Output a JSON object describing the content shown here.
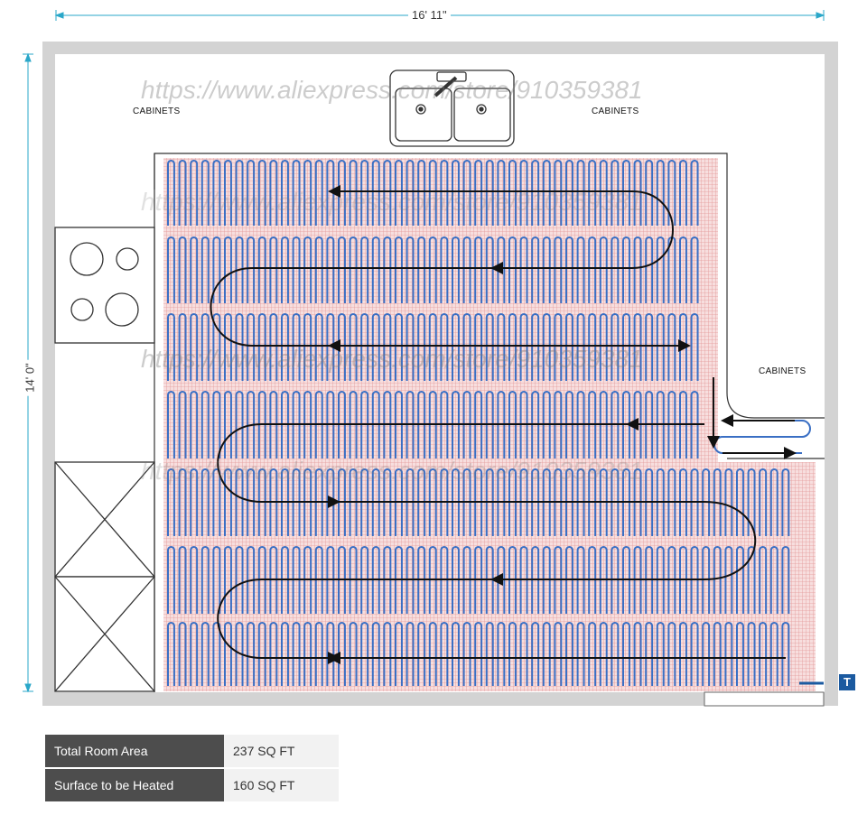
{
  "dimensions": {
    "width": "16' 11\"",
    "height": "14' 0\""
  },
  "cabinet_labels": [
    "CABINETS",
    "CABINETS",
    "CABINETS"
  ],
  "watermark": "https://www.aliexpress.com/store/910359381",
  "thermostat_symbol": "T",
  "specs": [
    {
      "label": "Total Room Area",
      "value": "237 SQ FT"
    },
    {
      "label": "Surface to be Heated",
      "value": "160 SQ FT"
    }
  ],
  "colors": {
    "wall": "#d3d3d3",
    "mesh": "#e8a0a0",
    "mesh_bg": "#f7dede",
    "cable": "#3a6fc4",
    "dimension": "#2aa7c9",
    "thermostat": "#1b5aa0",
    "label_bg": "#4d4d4d"
  },
  "icons": [
    "sink-icon",
    "cooktop-icon",
    "appliance-box-icon",
    "thermostat-icon",
    "arrow-icon"
  ]
}
